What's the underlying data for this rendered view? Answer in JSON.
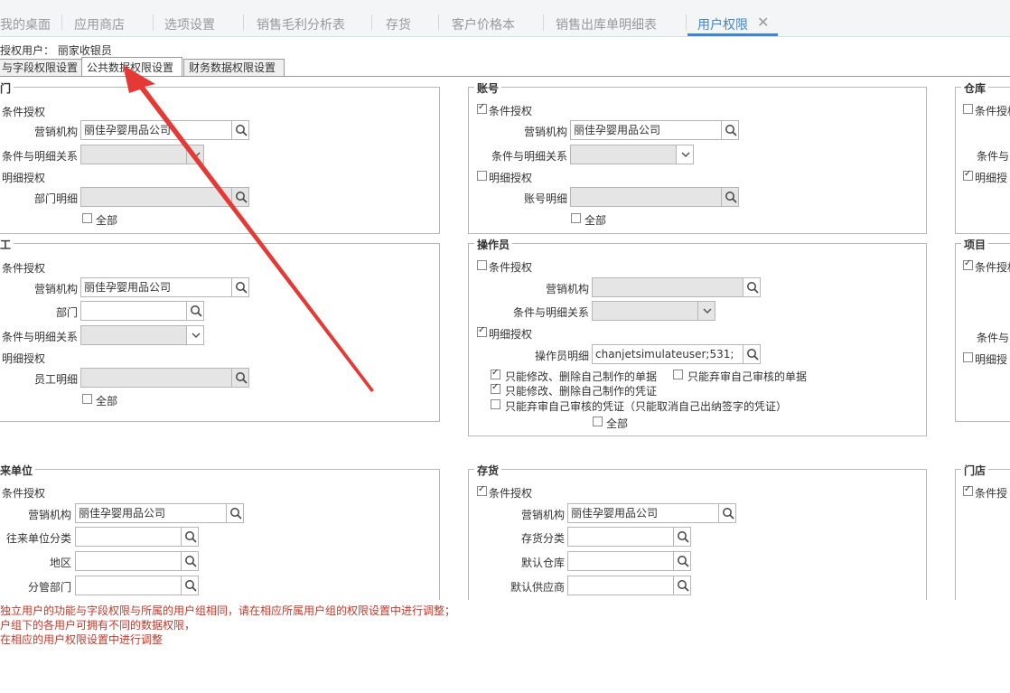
{
  "tabs": [
    "我的桌面",
    "应用商店",
    "选项设置",
    "销售毛利分析表",
    "存货",
    "客户价格本",
    "销售出库单明细表",
    "用户权限"
  ],
  "close_glyph": "✕",
  "user_line": "授权用户：  丽家收银员",
  "subtabs": [
    "与字段权限设置",
    "公共数据权限设置",
    "财务数据权限设置"
  ],
  "labels": {
    "cond": "条件授权",
    "detail": "明细授权",
    "org": "营销机构",
    "relation": "条件与明细关系",
    "all": "全部",
    "cond_trunc": "条件授权",
    "cond_lead": "条件授权",
    "detail_lead": "明细授权",
    "relation_trunc": "条件与",
    "detail_trunc": "明细授",
    "relation_trunc2": "条件与",
    "cond_trunc2": "条件授"
  },
  "org_value": "丽佳孕婴用品公司",
  "dept": {
    "legend": "门",
    "dept_detail": "部门明细"
  },
  "account": {
    "legend": "账号",
    "account_detail": "账号明细"
  },
  "warehouse": {
    "legend": "仓库"
  },
  "employee": {
    "legend": "工",
    "dept": "部门",
    "emp_detail": "员工明细"
  },
  "operator": {
    "legend": "操作员",
    "op_detail": "操作员明细",
    "op_value": "chanjetsimulateuser;531;",
    "opt1": "只能修改、删除自己制作的单据",
    "opt2": "只能弃审自己审核的单据",
    "opt3": "只能修改、删除自己制作的凭证",
    "opt4": "只能弃审自己审核的凭证（只能取消自己出纳签字的凭证）"
  },
  "project": {
    "legend": "项目"
  },
  "partner": {
    "legend": "来单位",
    "category": "往来单位分类",
    "region": "地区",
    "branch_dept": "分管部门"
  },
  "inventory": {
    "legend": "存货",
    "category": "存货分类",
    "default_wh": "默认仓库",
    "default_supplier": "默认供应商"
  },
  "store": {
    "legend": "门店"
  },
  "notes": [
    "独立用户的功能与字段权限与所属的用户组相同，请在相应所属用户组的权限设置中进行调整；",
    "户组下的各用户可拥有不同的数据权限，",
    "在相应的用户权限设置中进行调整"
  ]
}
